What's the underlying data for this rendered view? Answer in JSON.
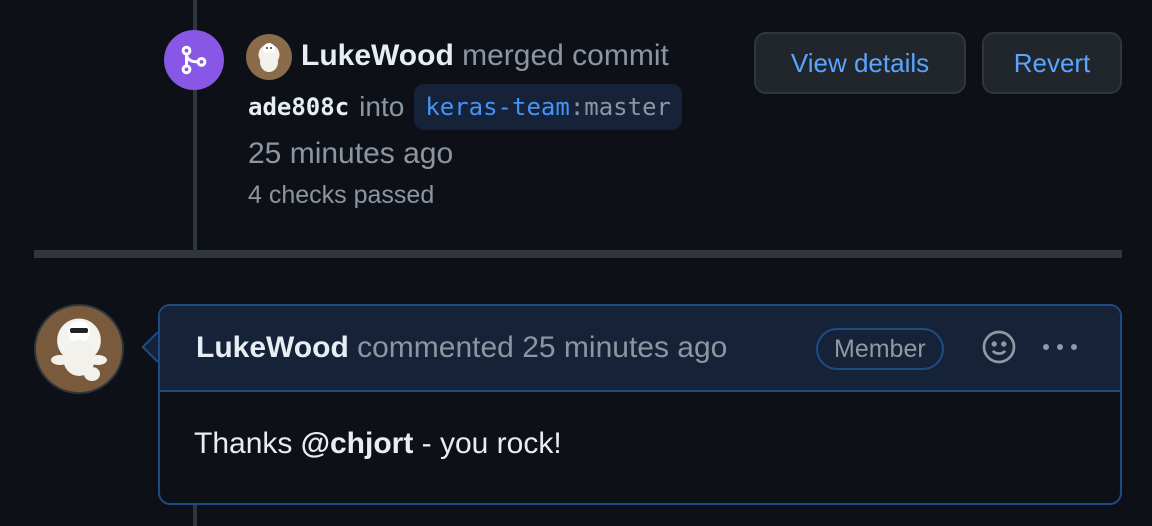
{
  "merge_event": {
    "icon": "git-merge-icon",
    "author": "LukeWood",
    "action": "merged commit",
    "sha": "ade808c",
    "into": "into",
    "branch_repo": "keras-team",
    "branch_sep": ":",
    "branch_name": "master",
    "time": "25 minutes ago",
    "checks": "4 checks passed",
    "view_details_label": "View details",
    "revert_label": "Revert"
  },
  "comment": {
    "author": "LukeWood",
    "action": "commented",
    "time": "25 minutes ago",
    "badge": "Member",
    "body_prefix": "Thanks ",
    "mention": "@chjort",
    "body_suffix": " - you rock!",
    "emoji_icon": "smiley-icon",
    "more_icon": "kebab-horizontal-icon"
  },
  "colors": {
    "background": "#0d1117",
    "merge_purple": "#8957e5",
    "link_blue": "#58a6ff",
    "comment_border": "#1f4b84"
  }
}
